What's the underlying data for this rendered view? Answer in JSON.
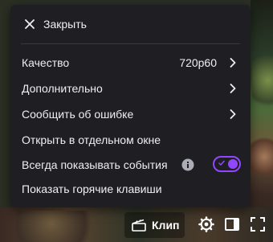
{
  "menu": {
    "close_label": "Закрыть",
    "items": [
      {
        "label": "Качество",
        "value": "720p60"
      },
      {
        "label": "Дополнительно"
      },
      {
        "label": "Сообщить об ошибке"
      },
      {
        "label": "Открыть в отдельном окне"
      },
      {
        "label": "Всегда показывать события",
        "toggle_on": true
      },
      {
        "label": "Показать горячие клавиши"
      }
    ]
  },
  "controls": {
    "clip_label": "Клип"
  },
  "colors": {
    "menu_bg": "#1f1f23",
    "text": "#efeff1",
    "accent": "#9147ff",
    "divider": "#3a3a3d"
  },
  "icons": [
    "close-icon",
    "chevron-right-icon",
    "info-icon",
    "clip-icon",
    "gear-icon",
    "theatre-mode-icon",
    "fullscreen-icon"
  ]
}
